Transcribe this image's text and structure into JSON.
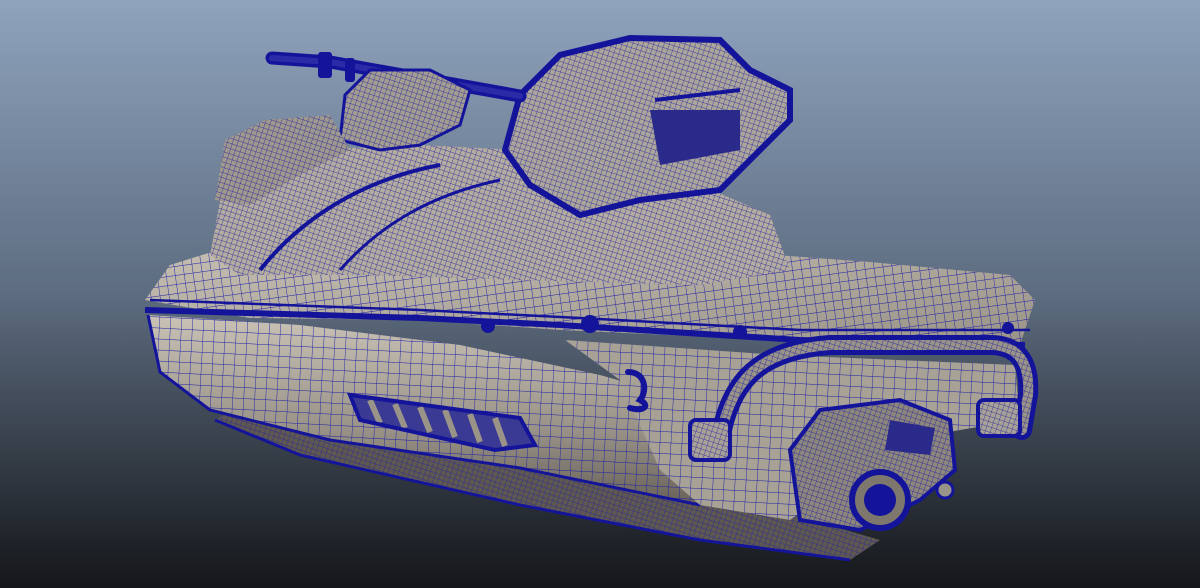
{
  "viewport": {
    "background_top": "#8ea3bd",
    "background_mid": "#5d6c80",
    "background_bottom": "#141619",
    "shaded": true,
    "wireframe_on_shaded": true
  },
  "model": {
    "object": "jet-ski",
    "surface_color": "#9a9388",
    "surface_highlight": "#c9c2b5",
    "surface_shadow": "#5e5850",
    "wire_color": "#1e1ea8",
    "wire_dense_color": "#14149a"
  }
}
